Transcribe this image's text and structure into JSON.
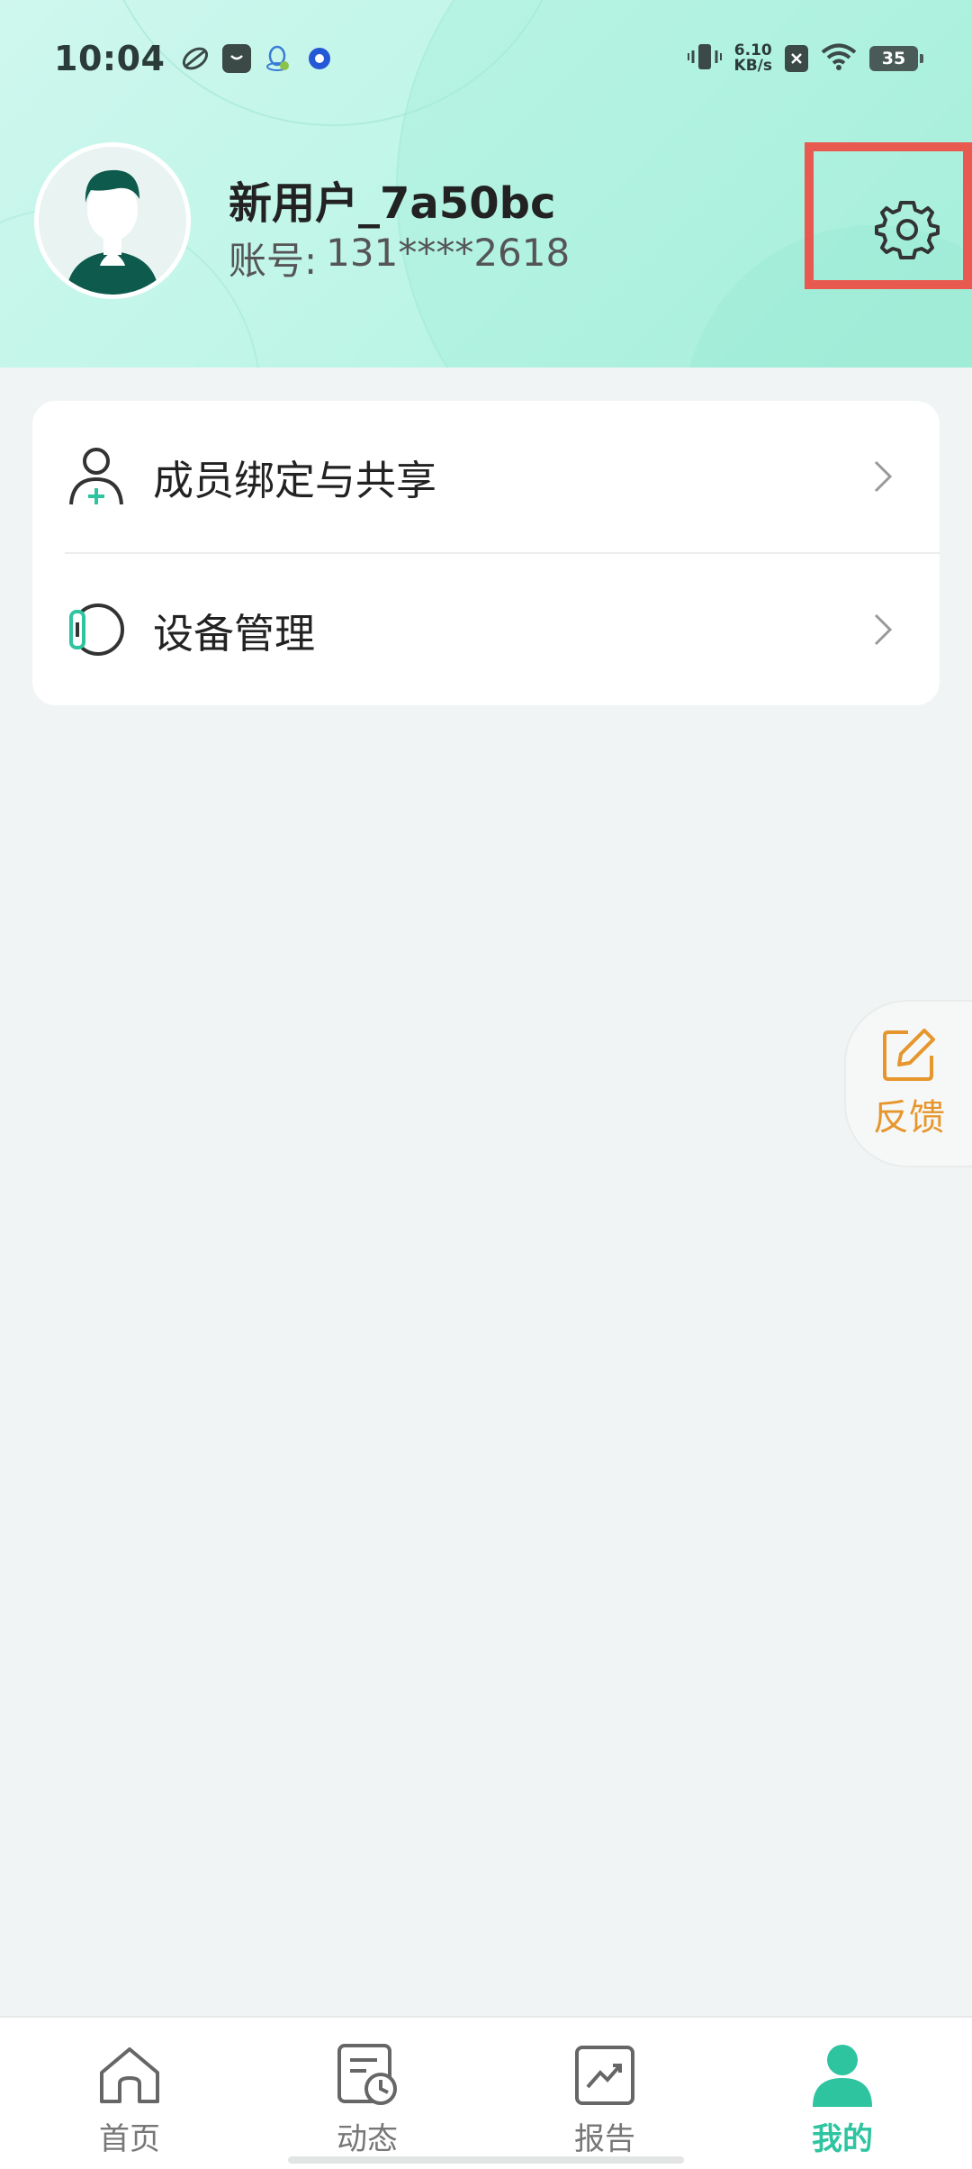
{
  "status_bar": {
    "time": "10:04",
    "net_speed_value": "6.10",
    "net_speed_unit": "KB/s",
    "battery": "35",
    "icons": [
      "app-icon-1",
      "shopping-bag-icon",
      "qq-icon",
      "browser-icon",
      "vibrate-icon",
      "sim-off-icon",
      "wifi-icon",
      "battery-icon"
    ]
  },
  "profile": {
    "name": "新用户_7a50bc",
    "account_label": "账号:",
    "account_value": "131****2618",
    "avatar": "default-avatar",
    "settings_icon": "gear-icon"
  },
  "menu": [
    {
      "label": "成员绑定与共享",
      "icon": "user-add-icon"
    },
    {
      "label": "设备管理",
      "icon": "device-icon"
    }
  ],
  "feedback": {
    "label": "反馈",
    "icon": "edit-icon",
    "color": "#e6962d"
  },
  "tabs": [
    {
      "label": "首页",
      "icon": "home-icon",
      "active": false
    },
    {
      "label": "动态",
      "icon": "activity-icon",
      "active": false
    },
    {
      "label": "报告",
      "icon": "report-icon",
      "active": false
    },
    {
      "label": "我的",
      "icon": "profile-icon",
      "active": true
    }
  ],
  "colors": {
    "accent": "#2ec4a0",
    "header_bg": "#bcf5e6",
    "highlight_box": "#e85a50",
    "feedback": "#e6962d"
  }
}
